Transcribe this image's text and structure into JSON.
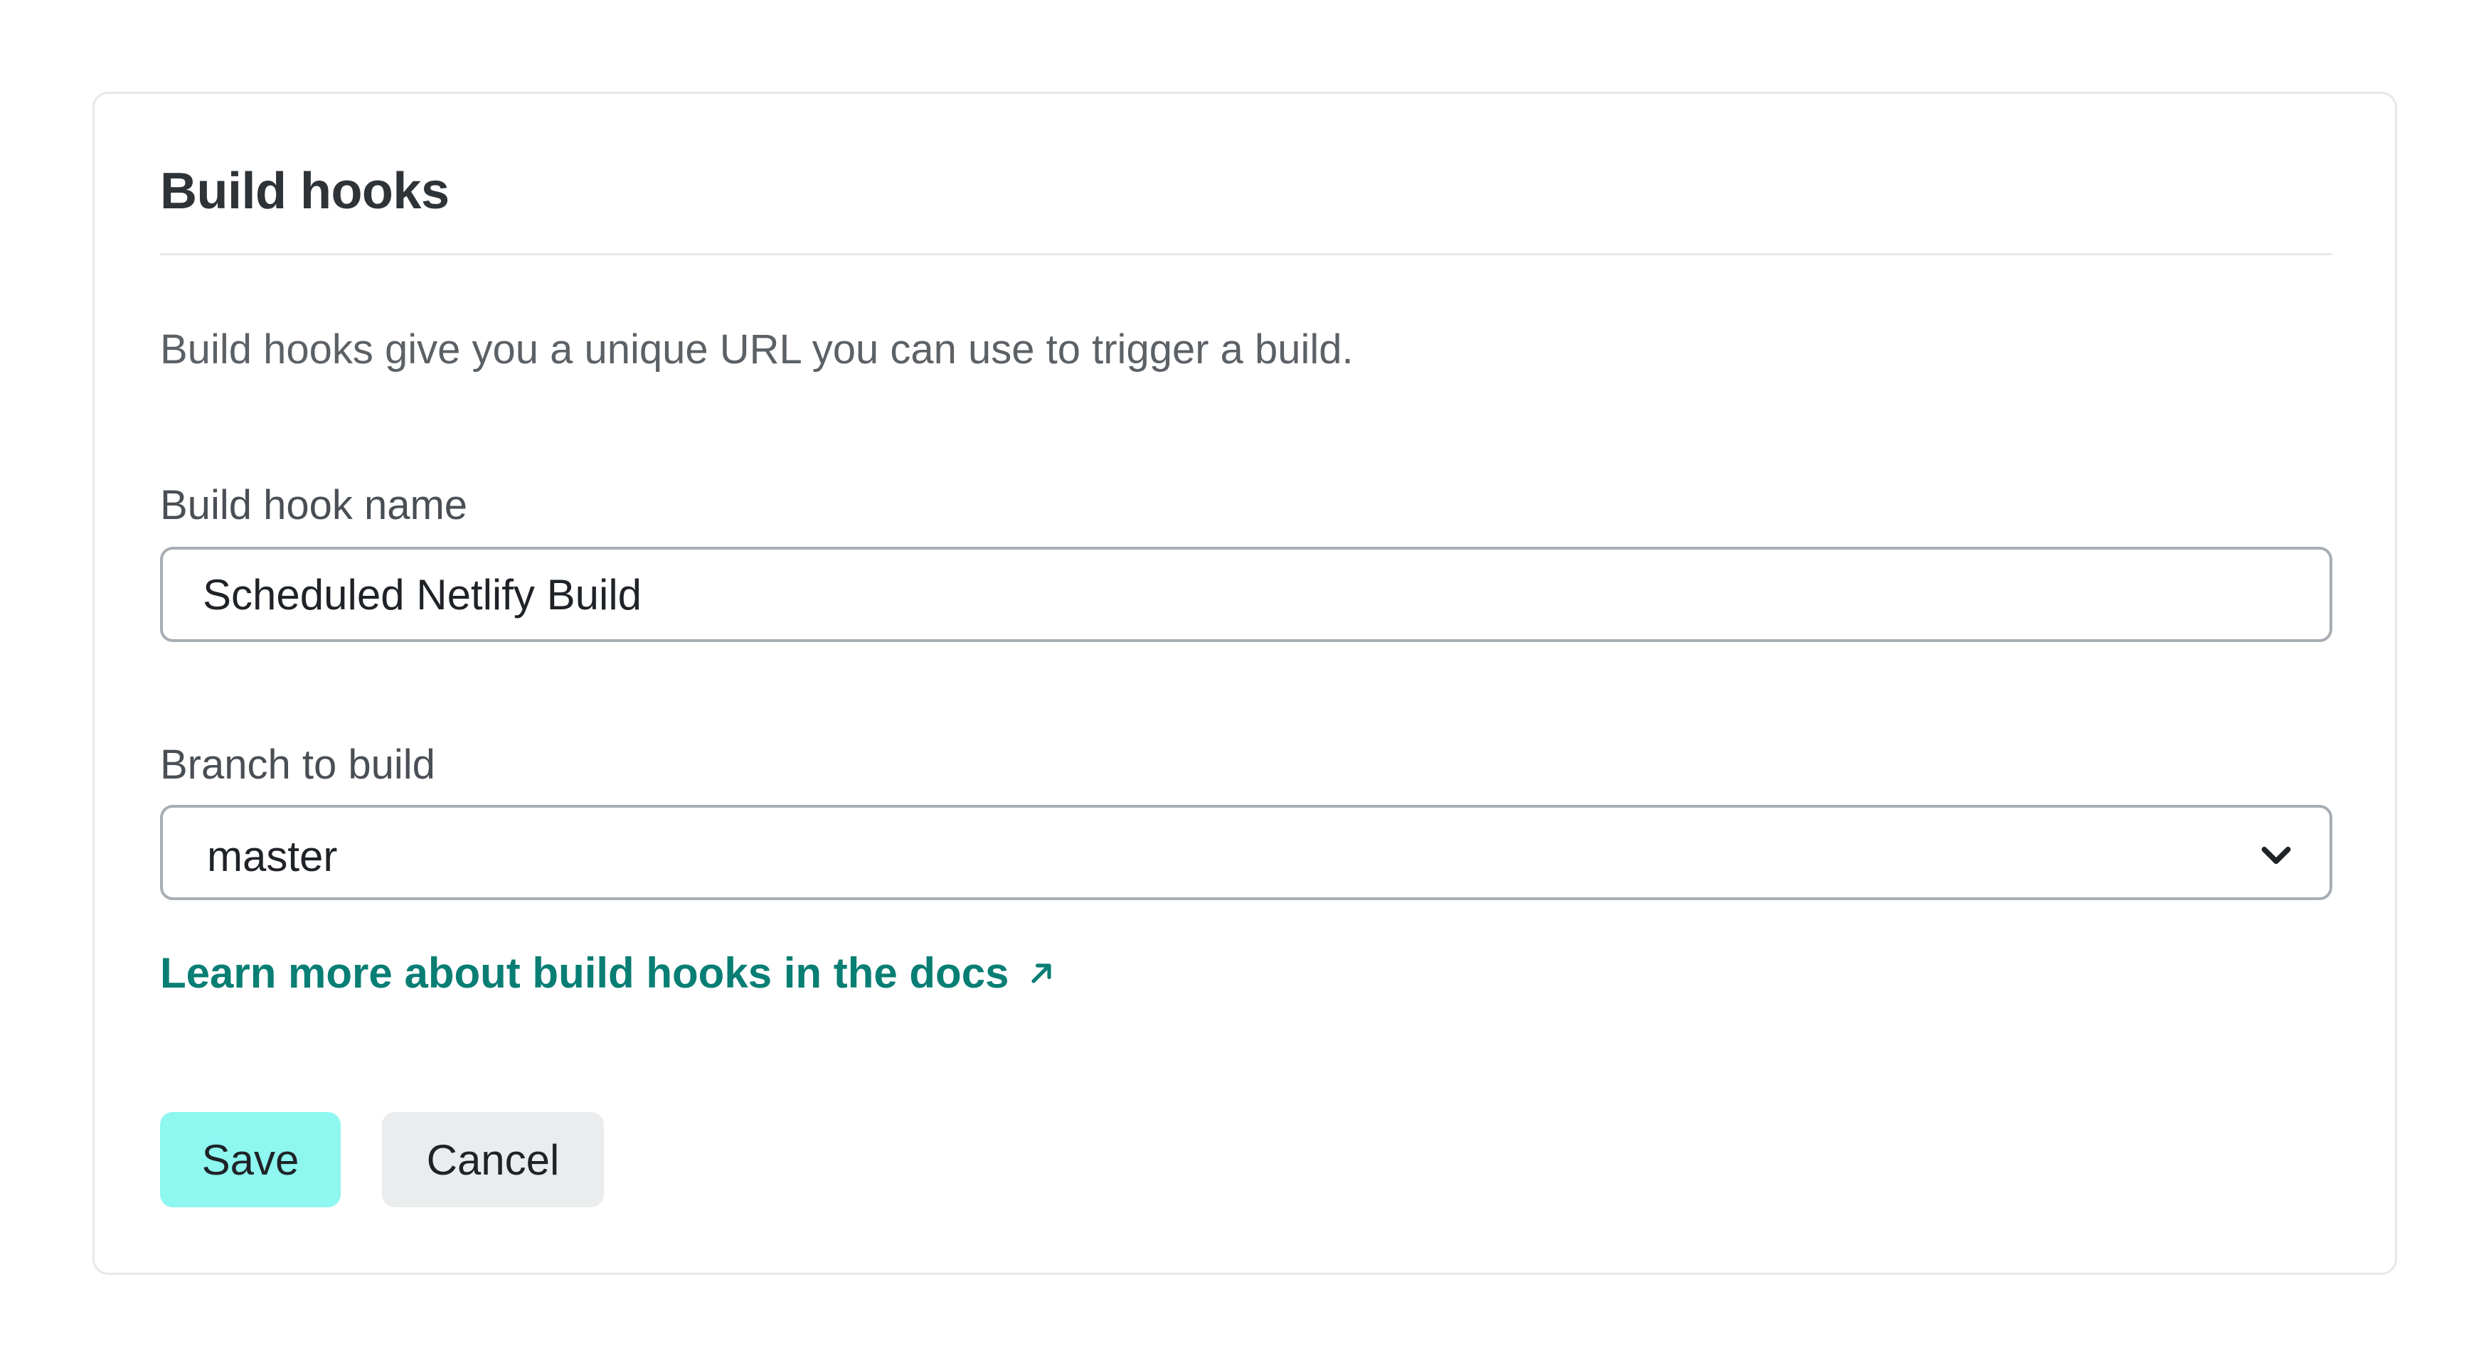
{
  "card": {
    "title": "Build hooks",
    "description": "Build hooks give you a unique URL you can use to trigger a build."
  },
  "form": {
    "name_label": "Build hook name",
    "name_value": "Scheduled Netlify Build",
    "branch_label": "Branch to build",
    "branch_value": "master"
  },
  "link": {
    "label": "Learn more about build hooks in the docs",
    "icon": "external-arrow-icon"
  },
  "buttons": {
    "save_label": "Save",
    "cancel_label": "Cancel"
  },
  "colors": {
    "link": "#087e74",
    "save_bg": "#8ef7f0",
    "cancel_bg": "#ebecee",
    "border": "#a8aeb3"
  }
}
